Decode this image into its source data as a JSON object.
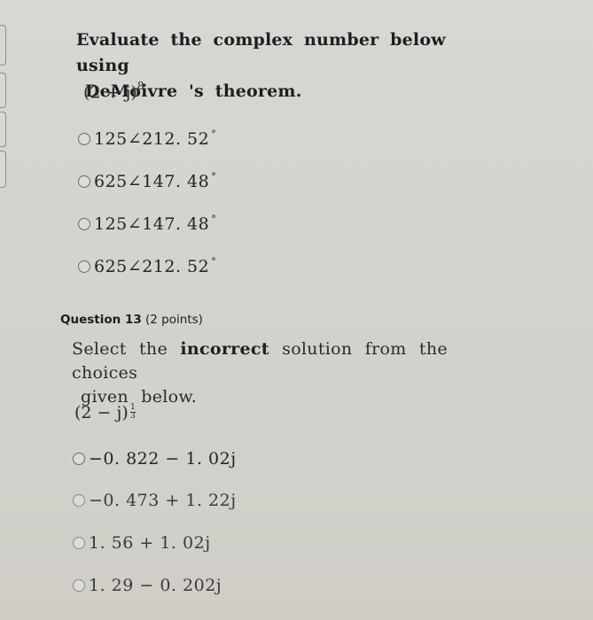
{
  "question12": {
    "prompt_line1": "Evaluate the complex number below using",
    "prompt_line2": "DeMoivre 's theorem.",
    "expression_base": "(2 + j)",
    "expression_exponent": "8",
    "options": [
      {
        "magnitude": "125",
        "angle_symbol": "∠",
        "angle": "212. 52",
        "degree": "°",
        "selected": false
      },
      {
        "magnitude": "625",
        "angle_symbol": "∠",
        "angle": "147. 48",
        "degree": "°",
        "selected": false
      },
      {
        "magnitude": "125",
        "angle_symbol": "∠",
        "angle": "147. 48",
        "degree": "°",
        "selected": false
      },
      {
        "magnitude": "625",
        "angle_symbol": "∠",
        "angle": "212. 52",
        "degree": "°",
        "selected": false
      }
    ]
  },
  "question13": {
    "heading": "Question 13",
    "points": "(2 points)",
    "prompt_pre": "Select the",
    "prompt_bold": "incorrect",
    "prompt_post": "solution from the choices",
    "prompt_line2": "given below.",
    "expression_base": "(2 − j)",
    "exponent_numerator": "1",
    "exponent_denominator": "3",
    "options": [
      {
        "label": "−0. 822 − 1. 02j",
        "selected": false
      },
      {
        "label": "−0. 473 + 1. 22j",
        "selected": false
      },
      {
        "label": "1. 56 + 1. 02j",
        "selected": false
      },
      {
        "label": "1. 29 − 0. 202j",
        "selected": false
      }
    ]
  }
}
